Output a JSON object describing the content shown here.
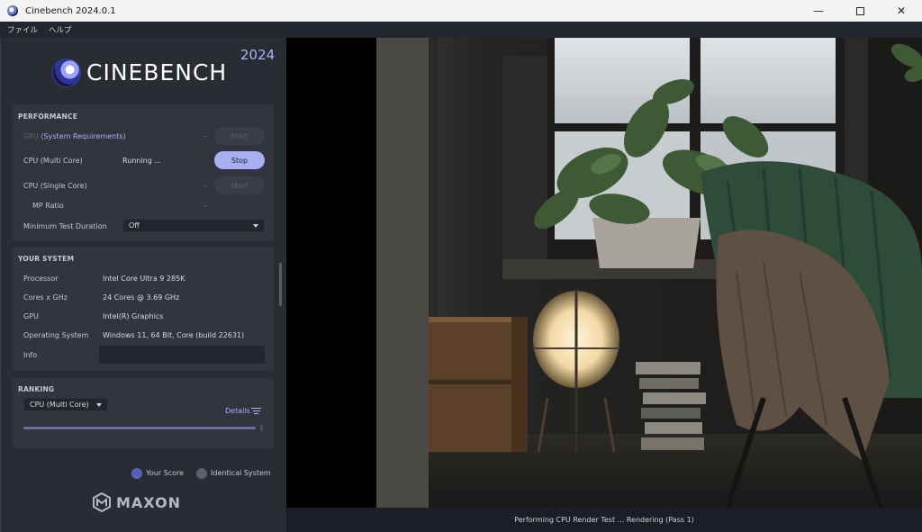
{
  "window": {
    "title": "Cinebench 2024.0.1"
  },
  "menu": {
    "items": [
      "ファイル",
      "ヘルプ"
    ]
  },
  "branding": {
    "logo_text": "CINEBENCH",
    "year": "2024",
    "footer_logo": "MAXON"
  },
  "performance": {
    "title": "PERFORMANCE",
    "gpu": {
      "label_prefix": "GPU",
      "link": "(System Requirements)",
      "value": "-",
      "button": "Start"
    },
    "cpu_multi": {
      "label": "CPU (Multi Core)",
      "value": "Running ...",
      "button": "Stop"
    },
    "cpu_single": {
      "label": "CPU (Single Core)",
      "value": "-",
      "button": "Start"
    },
    "mp_ratio": {
      "label": "MP Ratio",
      "value": "-"
    },
    "min_duration": {
      "label": "Minimum Test Duration",
      "value": "Off"
    }
  },
  "system": {
    "title": "YOUR SYSTEM",
    "processor": {
      "label": "Processor",
      "value": "Intel Core Ultra 9 285K"
    },
    "cores": {
      "label": "Cores x GHz",
      "value": "24 Cores @ 3.69 GHz"
    },
    "gpu": {
      "label": "GPU",
      "value": "Intel(R) Graphics"
    },
    "os": {
      "label": "Operating System",
      "value": "Windows 11, 64 Bit, Core (build 22631)"
    },
    "info": {
      "label": "Info",
      "value": ""
    }
  },
  "ranking": {
    "title": "RANKING",
    "selected": "CPU (Multi Core)",
    "details": "Details",
    "legend": {
      "your_score": "Your Score",
      "identical": "Identical System"
    }
  },
  "status": "Performing CPU Render Test ... Rendering (Pass 1)",
  "colors": {
    "accent": "#a9adf2",
    "your_score": "#5a5fb8",
    "identical_system": "#5d5e74"
  }
}
